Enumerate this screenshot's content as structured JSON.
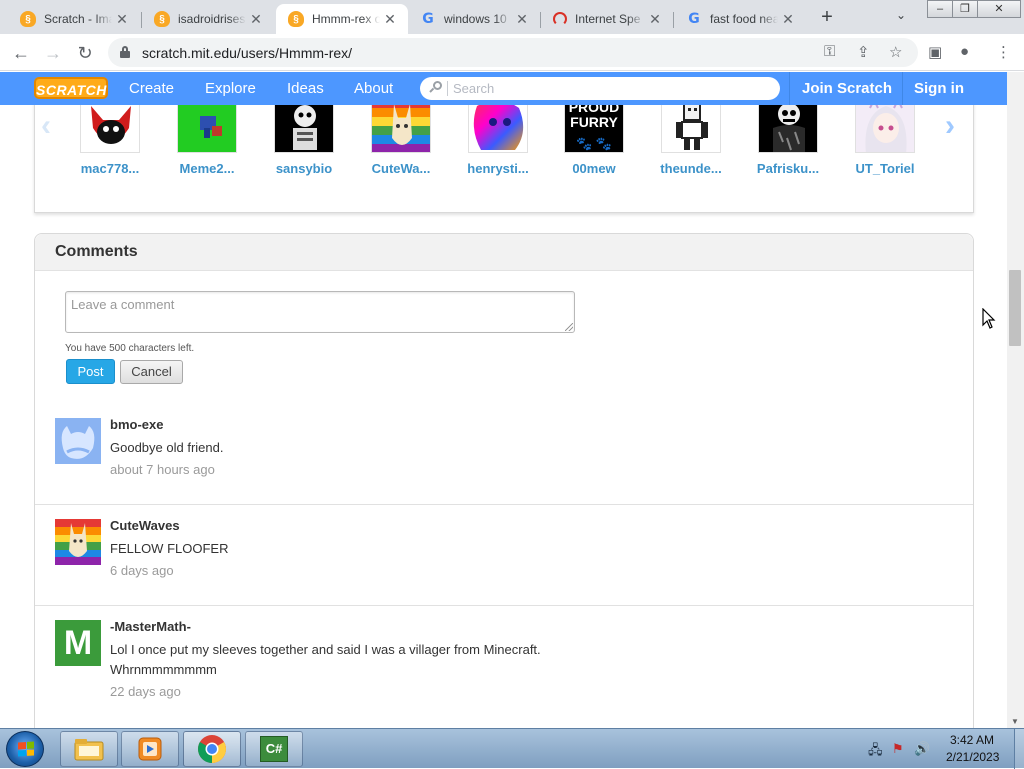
{
  "browser": {
    "tabs": [
      {
        "title": "Scratch - Ima",
        "favicon": "scratch-cat-icon",
        "active": false
      },
      {
        "title": "isadroidrises",
        "favicon": "scratch-cat-icon",
        "active": false
      },
      {
        "title": "Hmmm-rex o",
        "favicon": "scratch-cat-icon",
        "active": true
      },
      {
        "title": "windows 10",
        "favicon": "google-g-icon",
        "active": false
      },
      {
        "title": "Internet Spe",
        "favicon": "speedometer-icon",
        "active": false
      },
      {
        "title": "fast food nea",
        "favicon": "google-g-icon",
        "active": false
      }
    ],
    "close_glyph": "✕",
    "new_tab_glyph": "+",
    "tab_menu_glyph": "⌄",
    "window_controls": {
      "minimize": "–",
      "restore": "❐",
      "close": "✕"
    },
    "url": "scratch.mit.edu/users/Hmmm-rex/",
    "nav_glyphs": {
      "back": "←",
      "forward": "→",
      "reload": "↻"
    },
    "omnibox_icons": {
      "key": "⚿",
      "share": "⇪",
      "star": "☆"
    },
    "toolbar_icons": {
      "sidepanel": "▣",
      "profile": "●",
      "menu": "⋮"
    }
  },
  "scratch_nav": {
    "logo": "SCRATCH",
    "links": [
      "Create",
      "Explore",
      "Ideas",
      "About"
    ],
    "search_placeholder": "Search",
    "join": "Join Scratch",
    "signin": "Sign in",
    "brand_color": "#4d97ff"
  },
  "following": {
    "prev_glyph": "‹",
    "next_glyph": "›",
    "users": [
      {
        "name": "mac778...",
        "thumb": "red-black-cat-avatar"
      },
      {
        "name": "Meme2...",
        "thumb": "green-sprite-avatar"
      },
      {
        "name": "sansybio",
        "thumb": "skeleton-avatar"
      },
      {
        "name": "CuteWa...",
        "thumb": "rainbow-cat-avatar"
      },
      {
        "name": "henrysti...",
        "thumb": "rainbow-dog-avatar"
      },
      {
        "name": "00mew",
        "thumb": "proud-furry-avatar",
        "thumb_text_1": "PROUD",
        "thumb_text_2": "FURRY",
        "thumb_paws": "🐾 🐾"
      },
      {
        "name": "theunde...",
        "thumb": "pixel-character-avatar"
      },
      {
        "name": "Pafrisku...",
        "thumb": "dark-skeleton-avatar"
      },
      {
        "name": "UT_Toriel",
        "thumb": "anime-girl-avatar"
      }
    ]
  },
  "comments": {
    "heading": "Comments",
    "placeholder": "Leave a comment",
    "chars_left": "You have 500 characters left.",
    "post": "Post",
    "cancel": "Cancel",
    "items": [
      {
        "author": "bmo-exe",
        "text": [
          "Goodbye old friend."
        ],
        "time": "about 7 hours ago",
        "avatar": "scratch-cat-default-avatar"
      },
      {
        "author": "CuteWaves",
        "text": [
          "FELLOW FLOOFER"
        ],
        "time": "6 days ago",
        "avatar": "rainbow-cat-avatar"
      },
      {
        "author": "-MasterMath-",
        "text": [
          "Lol I once put my sleeves together and said I was a villager from Minecraft.",
          "Whrnmmmmmmm"
        ],
        "time": "22 days ago",
        "avatar": "green-m-avatar",
        "avatar_letter": "M"
      }
    ]
  },
  "taskbar": {
    "apps": [
      "file-explorer-icon",
      "media-player-icon",
      "chrome-icon",
      "csharp-icon"
    ],
    "csharp_label": "C#",
    "tray_glyphs": {
      "network": "🖧",
      "flag": "⚑",
      "volume": "🔊"
    },
    "clock_time": "3:42 AM",
    "clock_date": "2/21/2023"
  }
}
